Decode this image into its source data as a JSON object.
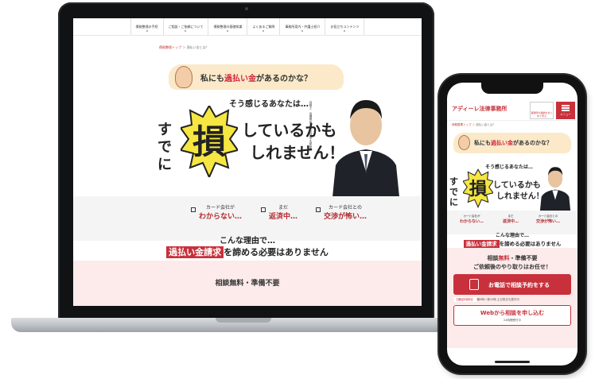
{
  "laptop": {
    "nav": [
      "債務整理の手続",
      "ご相談・ご依頼について",
      "債務整理の基礎知識",
      "よくあるご質問",
      "事務所案内・弁護士紹介",
      "お役立ちコンテンツ"
    ],
    "breadcrumb": {
      "home": "債務整理トップ",
      "current": "過払い金とは？"
    },
    "bubble": {
      "prefix": "私にも",
      "highlight": "過払い金",
      "suffix": "があるのかな？"
    },
    "intro": "そう感じるあなたは…",
    "side_text": "すでに",
    "burst_char": "損",
    "line1": "しているかも",
    "line2": "しれません！",
    "lawyer_caption": "弁護士　出縄雅 第一東京弁護士会所属",
    "checks": [
      {
        "top": "カード会社が",
        "red": "わからない…"
      },
      {
        "top": "まだ",
        "red": "返済中…"
      },
      {
        "top": "カード会社との",
        "red": "交渉が怖い…"
      }
    ],
    "reason_line": "こんな理由で…",
    "reason_label": "過払い金請求",
    "reason_rest": "を諦める必要はありません",
    "consult": "相談無料・準備不要"
  },
  "phone": {
    "logo": "アディーレ法律事務所",
    "login_label": "事務所の相談をまとめて見る",
    "menu_label": "メニュー",
    "breadcrumb": {
      "home": "債務整理トップ",
      "current": "過払い金とは？"
    },
    "bubble": {
      "prefix": "私にも",
      "highlight": "過払い金",
      "suffix": "があるのかな？"
    },
    "intro": "そう感じるあなたは…",
    "side_text": "すでに",
    "burst_char": "損",
    "line1": "しているかも",
    "line2": "しれません！",
    "checks": [
      {
        "top": "カード会社が",
        "red": "わからない…"
      },
      {
        "top": "まだ",
        "red": "返済中…"
      },
      {
        "top": "カード会社との",
        "red": "交渉が怖い…"
      }
    ],
    "reason_line": "こんな理由で…",
    "reason_label": "過払い金請求",
    "reason_rest": "を諦める必要はありません",
    "consult_prefix": "相談",
    "consult_red": "無料",
    "consult_suffix": "・準備不要",
    "consult2": "ご依頼後のやり取りはお任せ！",
    "cta_phone": "お電話で相談予約をする",
    "free_badge": "【通話料無料】",
    "free_text": "朝9時〜夜10時 土日祝日も受付中",
    "cta_web": "Webから相談を申し込む",
    "cta_web_sub": "24時間受付中"
  }
}
